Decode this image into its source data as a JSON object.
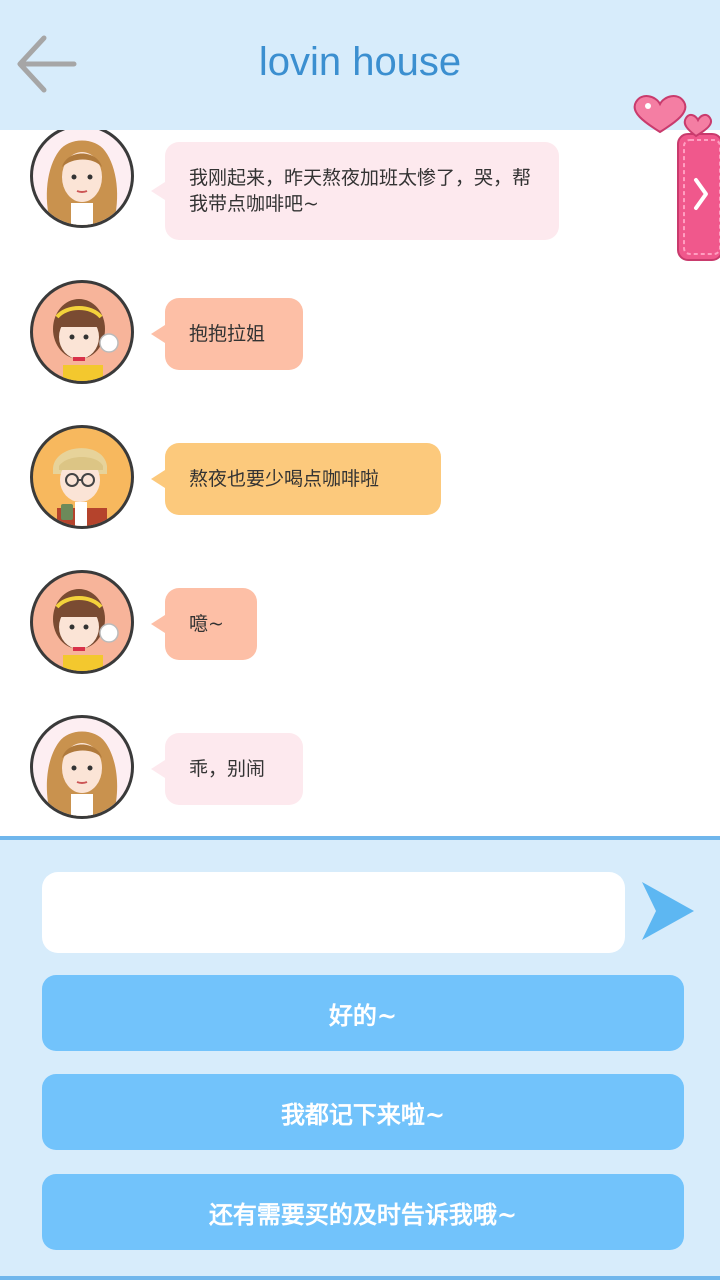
{
  "header": {
    "title": "lovin house",
    "back_icon": "arrow-left-icon"
  },
  "messages": [
    {
      "avatar": "girl-long-hair-avatar",
      "text": "我刚起来，昨天熬夜加班太惨了，哭，帮我带点咖啡吧~",
      "bubble_color": "#fde9ee"
    },
    {
      "avatar": "girl-bangs-avatar",
      "text": "抱抱拉姐",
      "bubble_color": "#fdbfa6"
    },
    {
      "avatar": "boy-glasses-avatar",
      "text": "熬夜也要少喝点咖啡啦",
      "bubble_color": "#fcc97c"
    },
    {
      "avatar": "girl-bangs-avatar",
      "text": "噫~",
      "bubble_color": "#fdbfa6"
    },
    {
      "avatar": "girl-long-hair-avatar",
      "text": "乖，别闹",
      "bubble_color": "#fde9ee"
    }
  ],
  "side_tab": {
    "icon": "heart-chevron-right-icon",
    "color": "#f0588c"
  },
  "composer": {
    "input_value": "",
    "input_placeholder": "",
    "send_icon": "send-arrow-icon"
  },
  "quick_replies": [
    {
      "label": "好的~"
    },
    {
      "label": "我都记下来啦~"
    },
    {
      "label": "还有需要买的及时告诉我哦~"
    }
  ],
  "colors": {
    "header_bg": "#d7ecfb",
    "title": "#3b8fd0",
    "reply_button": "#72c3fb",
    "send_icon": "#5db7f2"
  }
}
